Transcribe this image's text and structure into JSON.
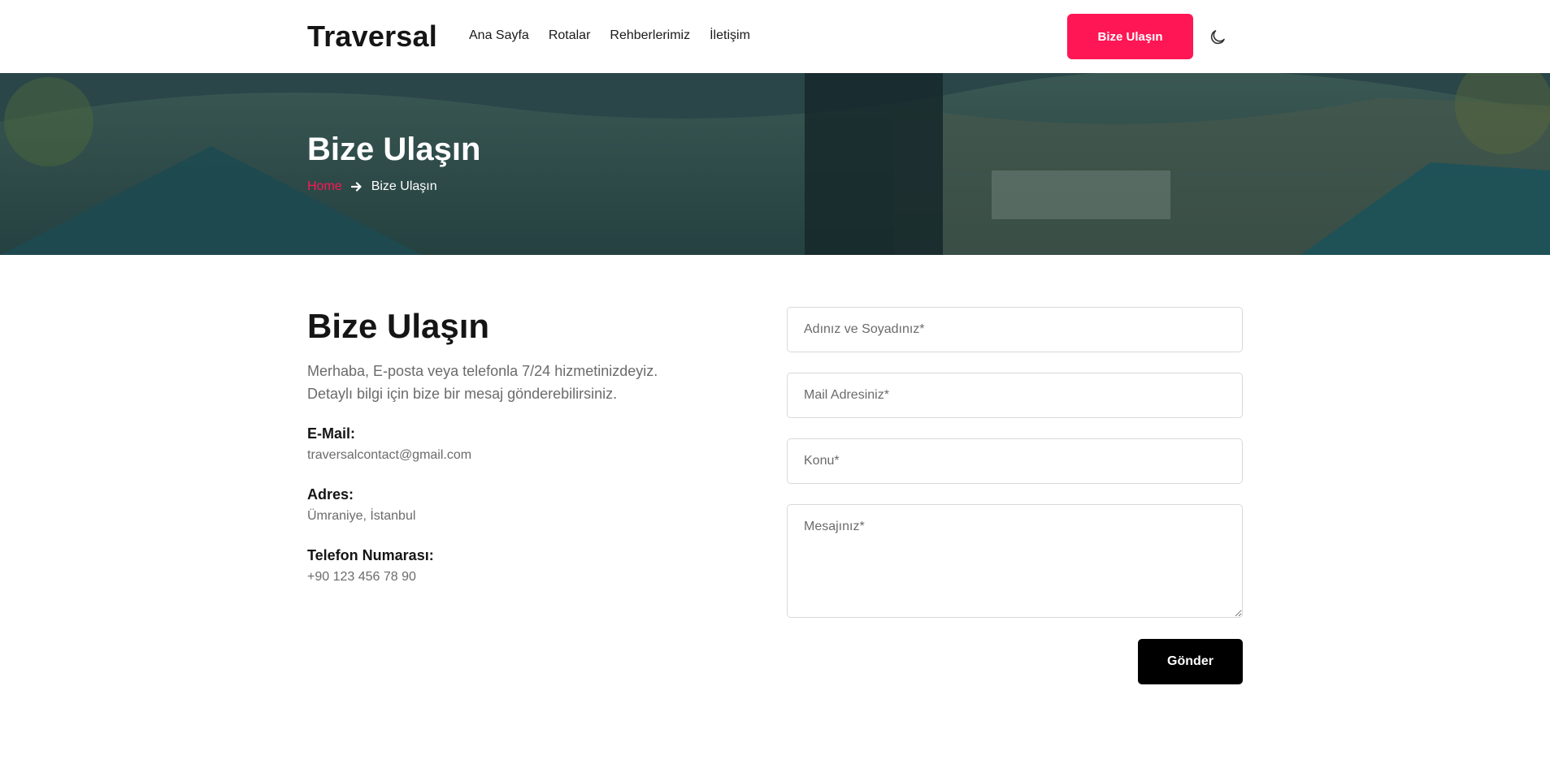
{
  "header": {
    "logo": "Traversal",
    "nav": [
      {
        "label": "Ana Sayfa"
      },
      {
        "label": "Rotalar"
      },
      {
        "label": "Rehberlerimiz"
      },
      {
        "label": "İletişim"
      }
    ],
    "cta_label": "Bize Ulaşın",
    "theme_icon": "moon-icon"
  },
  "hero": {
    "title": "Bize Ulaşın",
    "breadcrumb": {
      "home": "Home",
      "separator_icon": "arrow-right-icon",
      "current": "Bize Ulaşın"
    }
  },
  "contact": {
    "title": "Bize Ulaşın",
    "description_line1": "Merhaba, E-posta veya telefonla 7/24 hizmetinizdeyiz.",
    "description_line2": "Detaylı bilgi için bize bir mesaj gönderebilirsiniz.",
    "email_label": "E-Mail:",
    "email_value": "traversalcontact@gmail.com",
    "address_label": "Adres:",
    "address_value": "Ümraniye, İstanbul",
    "phone_label": "Telefon Numarası:",
    "phone_value": "+90 123 456 78 90"
  },
  "form": {
    "name_placeholder": "Adınız ve Soyadınız*",
    "email_placeholder": "Mail Adresiniz*",
    "subject_placeholder": "Konu*",
    "message_placeholder": "Mesajınız*",
    "submit_label": "Gönder"
  },
  "colors": {
    "accent": "#ff1654",
    "submit_bg": "#000000",
    "hero_overlay": "#1f3d40"
  }
}
